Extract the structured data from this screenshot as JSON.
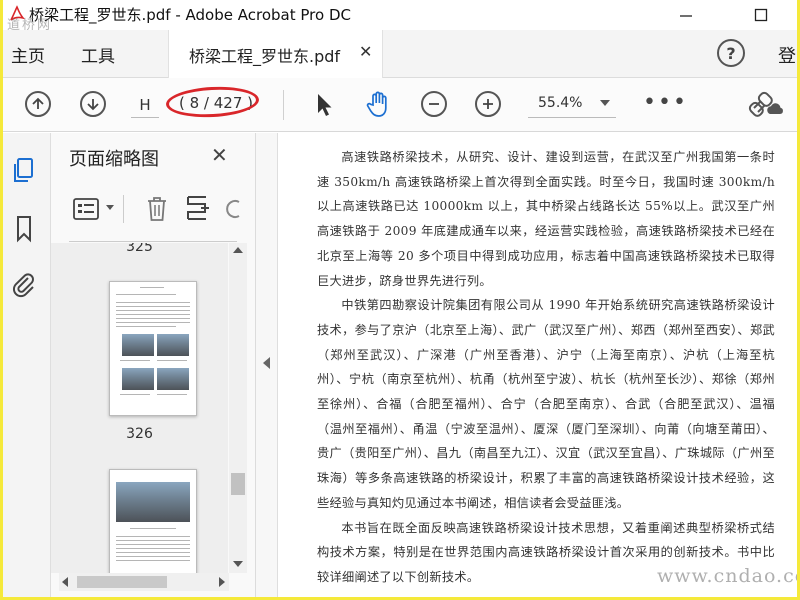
{
  "window": {
    "title": "桥梁工程_罗世东.pdf - Adobe Acrobat Pro DC",
    "watermark": "道桥网"
  },
  "nav": {
    "home": "主页",
    "tools": "工具",
    "doc_tab": "桥梁工程_罗世东.pdf",
    "help": "?",
    "login": "登"
  },
  "toolbar": {
    "page_input": "H",
    "page_count": "( 8 / 427 )",
    "zoom": "55.4%",
    "more": "•••"
  },
  "panel": {
    "title": "页面缩略图",
    "thumbnails": [
      {
        "page": "325"
      },
      {
        "page": "326"
      }
    ]
  },
  "document": {
    "paragraphs": [
      "高速铁路桥梁技术，从研究、设计、建设到运营，在武汉至广州我国第一条时速 350km/h 高速铁路桥梁上首次得到全面实践。时至今日，我国时速 300km/h 以上高速铁路已达 10000km 以上，其中桥梁占线路长达 55%以上。武汉至广州高速铁路于 2009 年底建成通车以来，经运营实践检验，高速铁路桥梁技术已经在北京至上海等 20 多个项目中得到成功应用，标志着中国高速铁路桥梁技术已取得巨大进步，跻身世界先进行列。",
      "中铁第四勘察设计院集团有限公司从 1990 年开始系统研究高速铁路桥梁设计技术，参与了京沪（北京至上海）、武广（武汉至广州）、郑西（郑州至西安）、郑武（郑州至武汉）、广深港（广州至香港）、沪宁（上海至南京）、沪杭（上海至杭州）、宁杭（南京至杭州）、杭甬（杭州至宁波）、杭长（杭州至长沙）、郑徐（郑州至徐州）、合福（合肥至福州）、合宁（合肥至南京）、合武（合肥至武汉）、温福（温州至福州）、甬温（宁波至温州）、厦深（厦门至深圳）、向莆（向塘至莆田）、贵广（贵阳至广州）、昌九（南昌至九江）、汉宜（武汉至宜昌）、广珠城际（广州至珠海）等多条高速铁路的桥梁设计，积累了丰富的高速铁路桥梁设计技术经验，这些经验与真知灼见通过本书阐述，相信读者会受益匪浅。",
      "本书旨在既全面反映高速铁路桥梁设计技术思想，又着重阐述典型桥梁桥式结构技术方案，特别是在世界范围内高速铁路桥梁设计首次采用的创新技术。书中比较详细阐述了以下创新技术。"
    ],
    "watermark": "www.cndao.com"
  }
}
